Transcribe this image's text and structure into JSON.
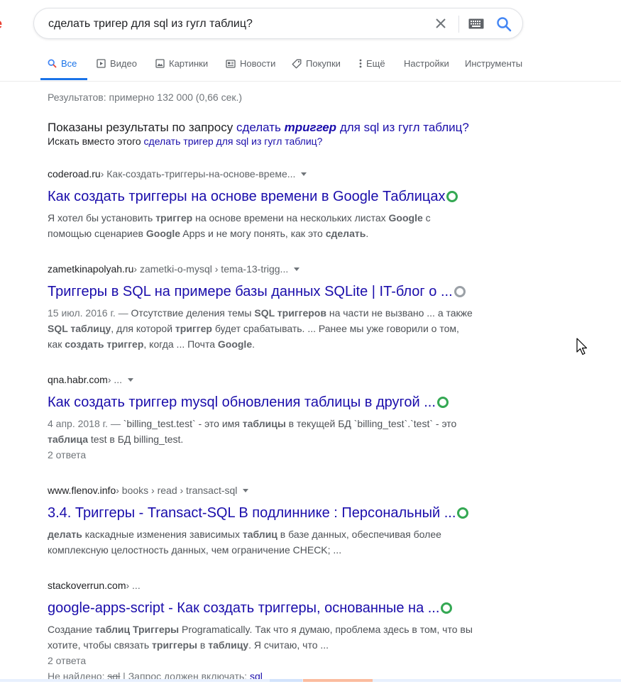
{
  "search": {
    "query": "сделать тригер для sql из гугл таблиц?"
  },
  "tabs": [
    {
      "label": "Все",
      "icon": "search-icon",
      "active": true
    },
    {
      "label": "Видео",
      "icon": "video-icon"
    },
    {
      "label": "Картинки",
      "icon": "image-icon"
    },
    {
      "label": "Новости",
      "icon": "news-icon"
    },
    {
      "label": "Покупки",
      "icon": "tag-icon"
    },
    {
      "label": "Ещё",
      "icon": "more-vert-icon"
    },
    {
      "label": "Настройки"
    },
    {
      "label": "Инструменты"
    }
  ],
  "stats": "Результатов: примерно 132 000 (0,66 сек.)",
  "spell": {
    "showing_prefix": "Показаны результаты по запросу",
    "corrected_1": "сделать",
    "corrected_bold": "триггер",
    "corrected_2": "для sql из гугл таблиц?",
    "instead_prefix": "Искать вместо этого",
    "original_query": "сделать тригер для sql из гугл таблиц?"
  },
  "results": [
    {
      "site": "coderoad.ru",
      "path": " › Как-создать-триггеры-на-основе-време...",
      "title": "Как создать триггеры на основе времени в Google Таблицах",
      "badge": "green",
      "snippet_parts": [
        {
          "t": "Я хотел бы установить "
        },
        {
          "t": "триггер",
          "b": true
        },
        {
          "t": " на основе времени на нескольких листах "
        },
        {
          "t": "Google",
          "b": true
        },
        {
          "t": " с помощью сценариев "
        },
        {
          "t": "Google",
          "b": true
        },
        {
          "t": " Apps и не могу понять, как это "
        },
        {
          "t": "сделать",
          "b": true
        },
        {
          "t": "."
        }
      ]
    },
    {
      "site": "zametkinapolyah.ru",
      "path": " › zametki-o-mysql › tema-13-trigg...",
      "title": "Триггеры в SQL на примере базы данных SQLite | IT-блог о ...",
      "badge": "grey",
      "date": "15 июл. 2016 г. — ",
      "snippet_parts": [
        {
          "t": "Отсутствие деления темы "
        },
        {
          "t": "SQL триггеров",
          "b": true
        },
        {
          "t": " на части не вызвано ... а также "
        },
        {
          "t": "SQL таблицу",
          "b": true
        },
        {
          "t": ", для которой "
        },
        {
          "t": "триггер",
          "b": true
        },
        {
          "t": " будет срабатывать. ... Ранее мы уже говорили о том, как "
        },
        {
          "t": "создать триггер",
          "b": true
        },
        {
          "t": ", когда ... Почта "
        },
        {
          "t": "Google",
          "b": true
        },
        {
          "t": "."
        }
      ]
    },
    {
      "site": "qna.habr.com",
      "path": " › ...",
      "title": "Как создать триггер mysql обновления таблицы в другой ...",
      "badge": "green",
      "date": "4 апр. 2018 г. — ",
      "snippet_parts": [
        {
          "t": "`billing_test.test` - это имя "
        },
        {
          "t": "таблицы",
          "b": true
        },
        {
          "t": " в текущей БД `billing_test`.`test` - это "
        },
        {
          "t": "таблица",
          "b": true
        },
        {
          "t": " test в БД billing_test."
        }
      ],
      "answers": "2 ответа"
    },
    {
      "site": "www.flenov.info",
      "path": " › books › read › transact-sql",
      "title": "3.4. Триггеры - Transact-SQL В подлиннике : Персональный ...",
      "badge": "green",
      "snippet_parts": [
        {
          "t": "делать",
          "b": true
        },
        {
          "t": " каскадные изменения зависимых "
        },
        {
          "t": "таблиц",
          "b": true
        },
        {
          "t": " в базе данных, обеспечивая более комплексную целостность данных, чем ограничение CHECK; ..."
        }
      ]
    },
    {
      "site": "stackoverrun.com",
      "path": " › ...",
      "title": "google-apps-script - Как создать триггеры, основанные на ...",
      "badge": "green",
      "snippet_parts": [
        {
          "t": "Создание "
        },
        {
          "t": "таблиц Триггеры",
          "b": true
        },
        {
          "t": " Programatically. Так что я думаю, проблема здесь в том, что вы хотите, чтобы связать "
        },
        {
          "t": "триггеры",
          "b": true
        },
        {
          "t": " в "
        },
        {
          "t": "таблицу",
          "b": true
        },
        {
          "t": ". Я считаю, что ..."
        }
      ],
      "answers": "2 ответа",
      "missing_prefix": "Не найдено: ",
      "missing_word": "sql",
      "missing_mid": " | Запрос должен включать: ",
      "missing_link": "sql"
    }
  ]
}
